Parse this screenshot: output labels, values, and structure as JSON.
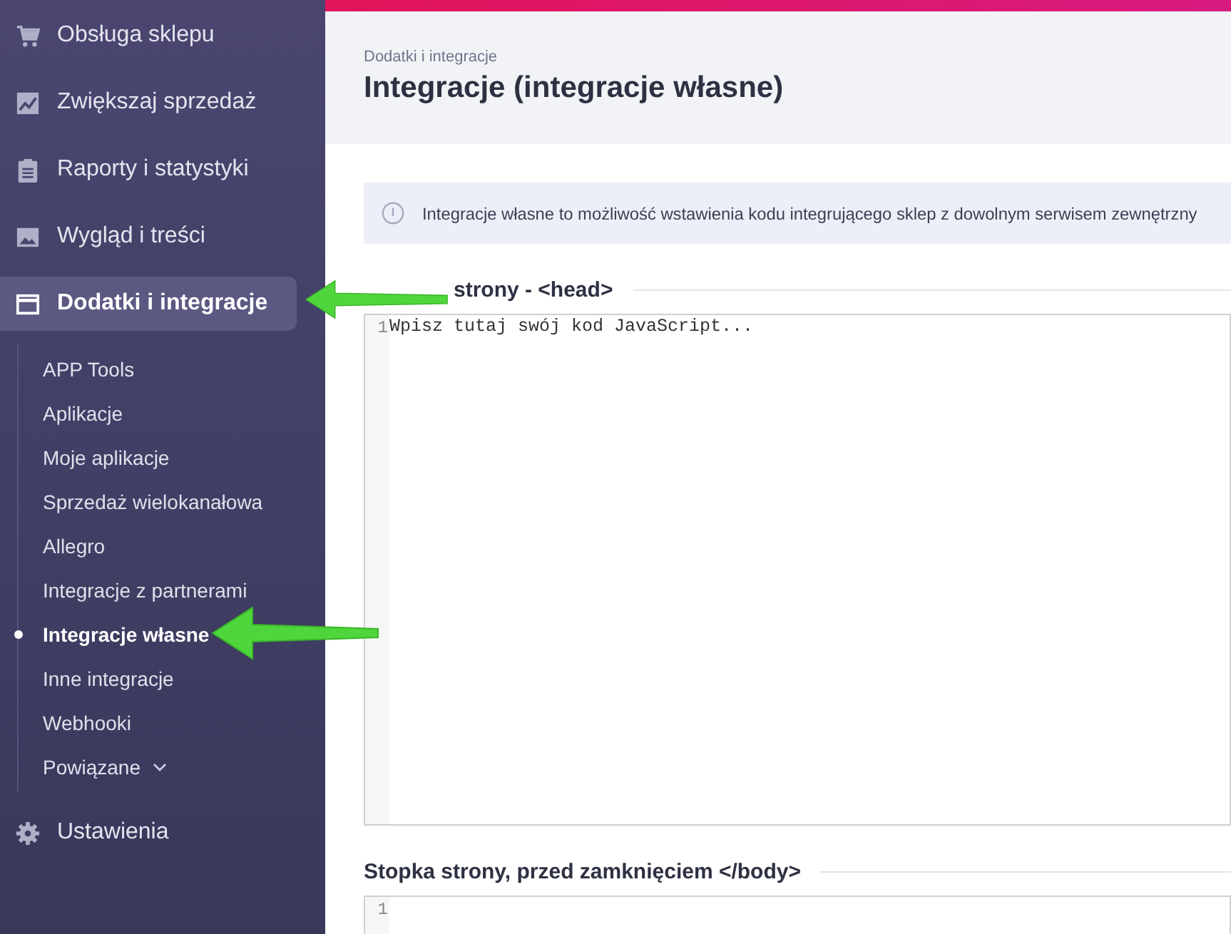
{
  "sidebar": {
    "items": [
      {
        "label": "Obsługa sklepu",
        "selected": false
      },
      {
        "label": "Zwiększaj sprzedaż",
        "selected": false
      },
      {
        "label": "Raporty i statystyki",
        "selected": false
      },
      {
        "label": "Wygląd i treści",
        "selected": false
      },
      {
        "label": "Dodatki i integracje",
        "selected": true,
        "children": [
          {
            "label": "APP Tools",
            "selected": false
          },
          {
            "label": "Aplikacje",
            "selected": false
          },
          {
            "label": "Moje aplikacje",
            "selected": false
          },
          {
            "label": "Sprzedaż wielokanałowa",
            "selected": false
          },
          {
            "label": "Allegro",
            "selected": false
          },
          {
            "label": "Integracje z partnerami",
            "selected": false
          },
          {
            "label": "Integracje własne",
            "selected": true
          },
          {
            "label": "Inne integracje",
            "selected": false
          },
          {
            "label": "Webhooki",
            "selected": false
          },
          {
            "label": "Powiązane",
            "selected": false,
            "expanded": false
          }
        ]
      },
      {
        "label": "Ustawienia",
        "selected": false
      }
    ]
  },
  "header": {
    "breadcrumb": "Dodatki i integracje",
    "title": "Integracje (integracje własne)"
  },
  "notice": {
    "text": "Integracje własne to możliwość wstawienia kodu integrującego sklep z dowolnym serwisem zewnętrzny"
  },
  "sections": [
    {
      "heading": "strony - <head>",
      "editor": {
        "line_numbers": [
          "1"
        ],
        "placeholder": "Wpisz tutaj swój kod JavaScript..."
      }
    },
    {
      "heading": "Stopka strony, przed zamknięciem </body>",
      "editor": {
        "line_numbers": [
          "1"
        ]
      }
    }
  ]
}
